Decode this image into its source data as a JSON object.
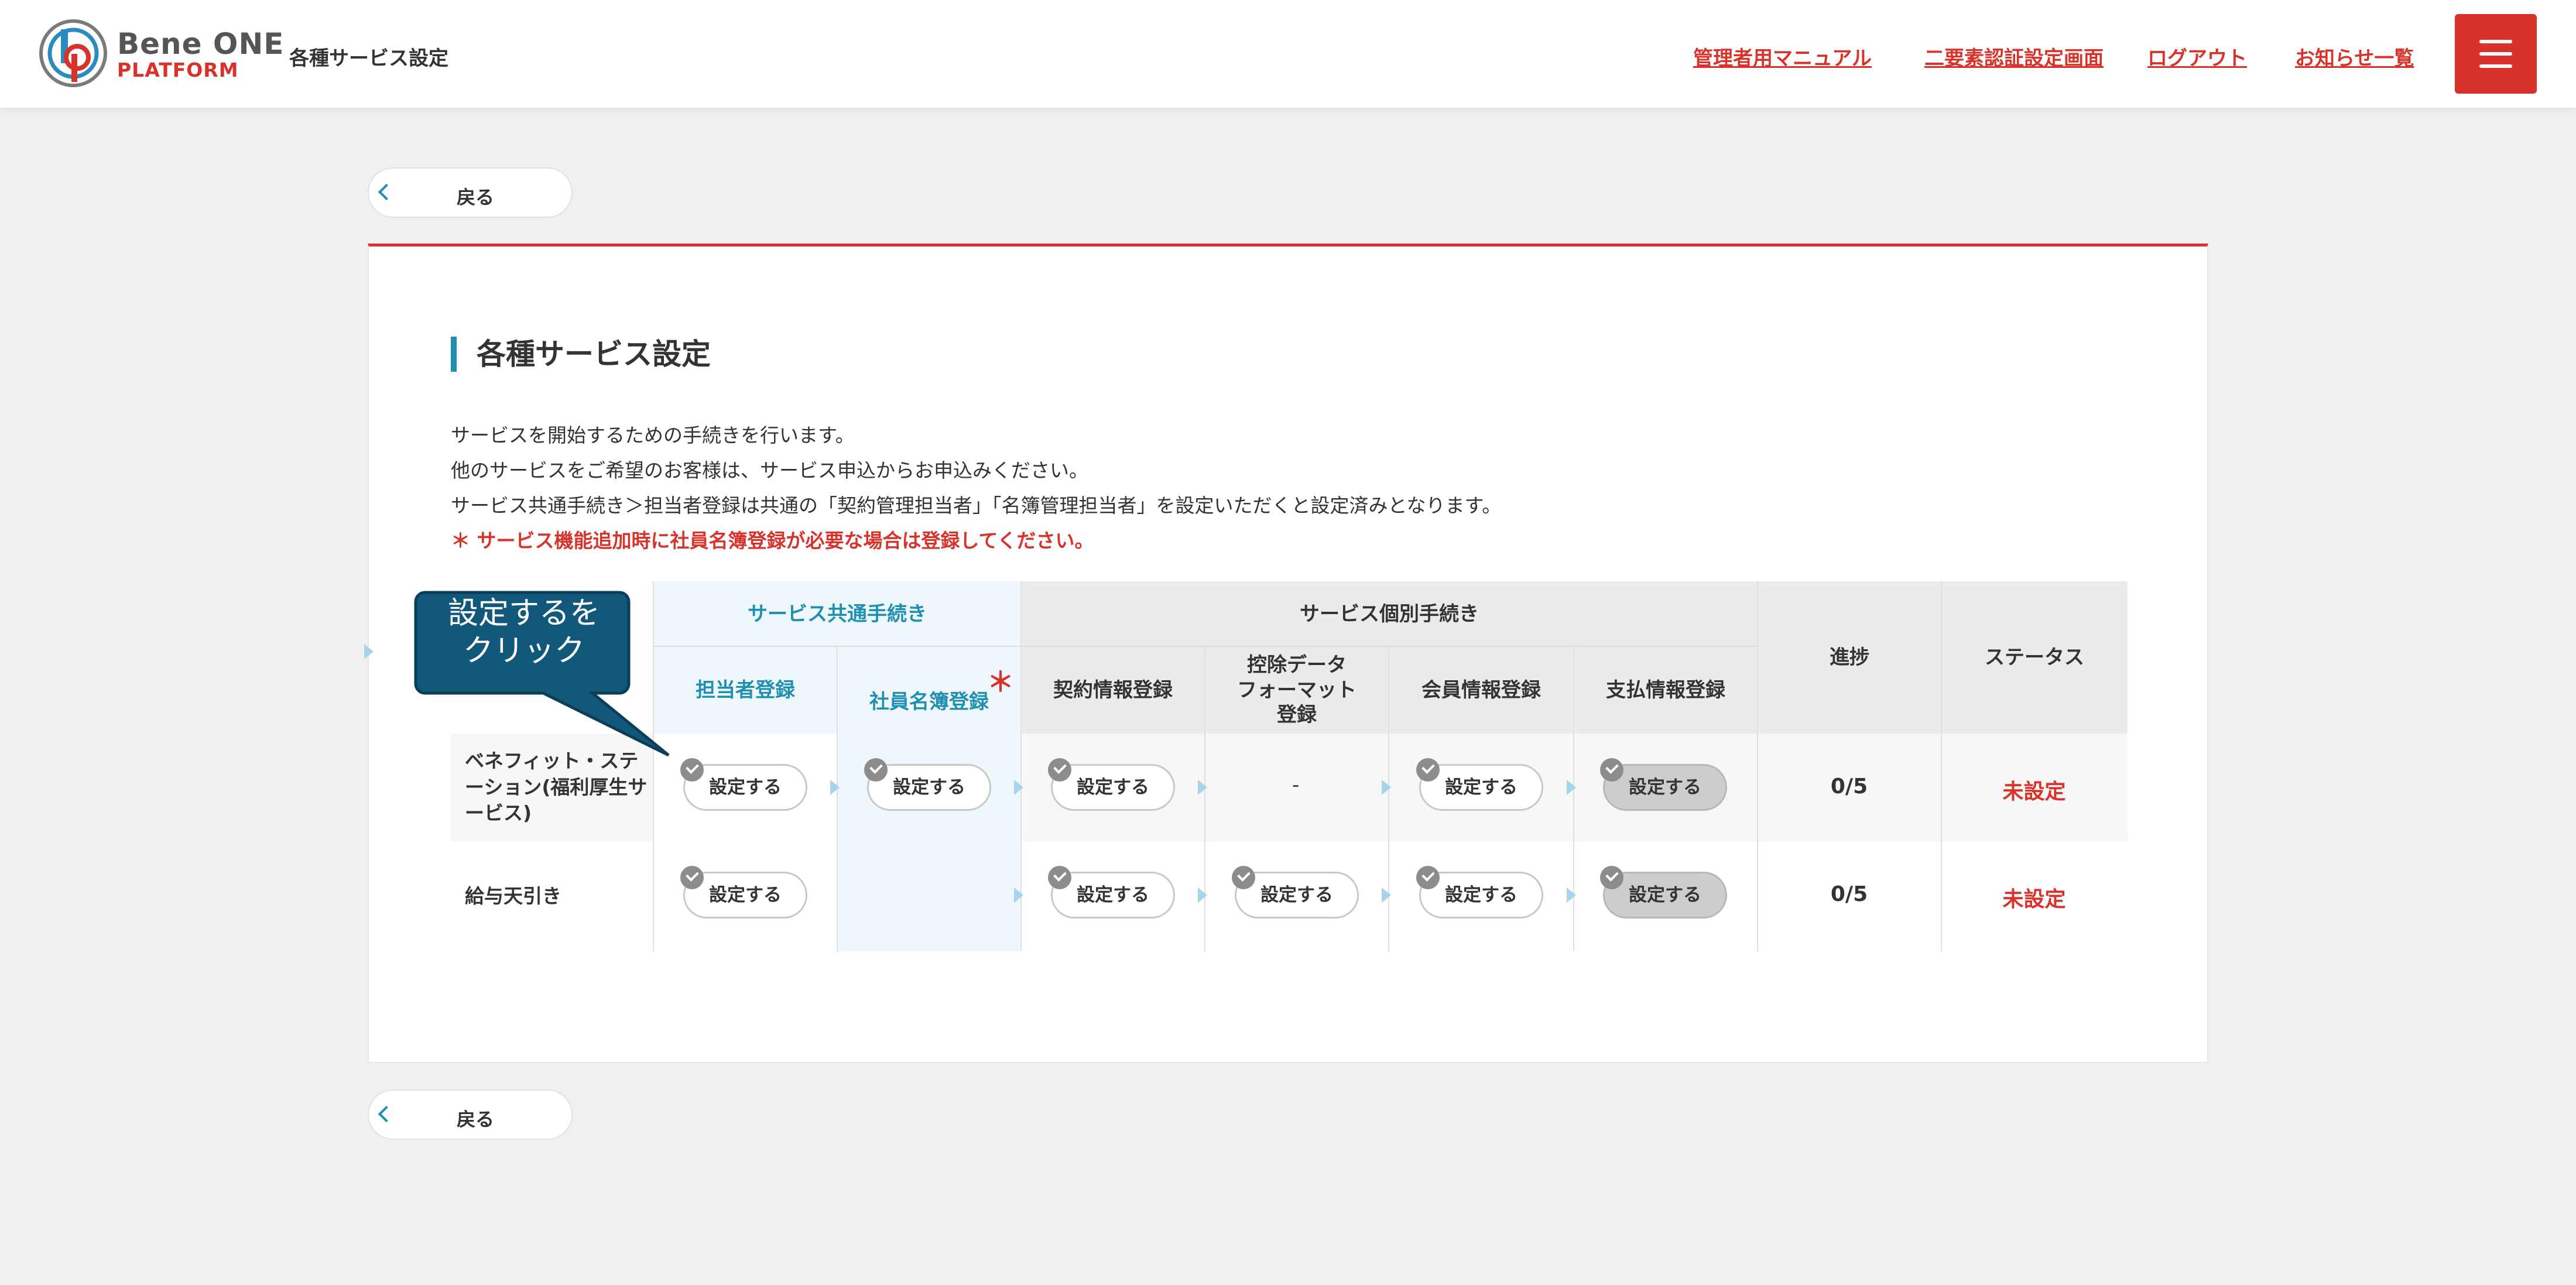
{
  "header": {
    "logo_line1": "Bene ONE",
    "logo_line2": "PLATFORM",
    "title": "各種サービス設定",
    "nav": [
      "管理者用マニュアル",
      "二要素認証設定画面",
      "ログアウト",
      "お知らせ一覧"
    ]
  },
  "back_label": "戻る",
  "page": {
    "title": "各種サービス設定",
    "desc": [
      "サービスを開始するための手続きを行います。",
      "他のサービスをご希望のお客様は、サービス申込からお申込みください。",
      "サービス共通手続き＞担当者登録は共通の「契約管理担当者」「名簿管理担当者」を設定いただくと設定済みとなります。"
    ],
    "note": "＊ サービス機能追加時に社員名簿登録が必要な場合は登録してください。"
  },
  "table": {
    "group_common": "サービス共通手続き",
    "group_individual": "サービス個別手続き",
    "cols": [
      "担当者登録",
      "社員名簿登録",
      "契約情報登録",
      "控除データ\nフォーマット\n登録",
      "会員情報登録",
      "支払情報登録"
    ],
    "required_mark": "＊",
    "col_progress": "進捗",
    "col_status": "ステータス",
    "rows": [
      {
        "name": "ベネフィット・ステーション(福利厚生サービス)",
        "progress": "0/5",
        "status": "未設定"
      },
      {
        "name": "給与天引き",
        "progress": "0/5",
        "status": "未設定"
      }
    ],
    "button_label": "設定する",
    "dash": "-"
  },
  "callout": {
    "line1": "設定するを",
    "line2": "クリック"
  },
  "colors": {
    "accent_red": "#d8322a",
    "accent_blue": "#1e8fb0",
    "callout_bg": "#11587a"
  }
}
